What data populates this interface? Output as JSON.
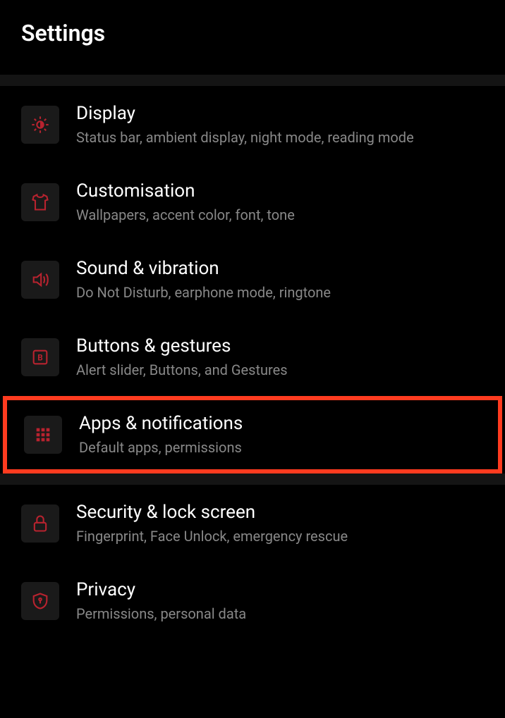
{
  "header": {
    "title": "Settings"
  },
  "sections": [
    {
      "items": [
        {
          "icon": "display",
          "title": "Display",
          "subtitle": "Status bar, ambient display, night mode, reading mode",
          "highlighted": false
        },
        {
          "icon": "customisation",
          "title": "Customisation",
          "subtitle": "Wallpapers, accent color, font, tone",
          "highlighted": false
        },
        {
          "icon": "sound",
          "title": "Sound & vibration",
          "subtitle": "Do Not Disturb, earphone mode, ringtone",
          "highlighted": false
        },
        {
          "icon": "buttons",
          "title": "Buttons & gestures",
          "subtitle": "Alert slider, Buttons, and Gestures",
          "highlighted": false
        },
        {
          "icon": "apps",
          "title": "Apps & notifications",
          "subtitle": "Default apps, permissions",
          "highlighted": true
        }
      ]
    },
    {
      "items": [
        {
          "icon": "security",
          "title": "Security & lock screen",
          "subtitle": "Fingerprint, Face Unlock, emergency rescue",
          "highlighted": false
        },
        {
          "icon": "privacy",
          "title": "Privacy",
          "subtitle": "Permissions, personal data",
          "highlighted": false
        }
      ]
    }
  ]
}
